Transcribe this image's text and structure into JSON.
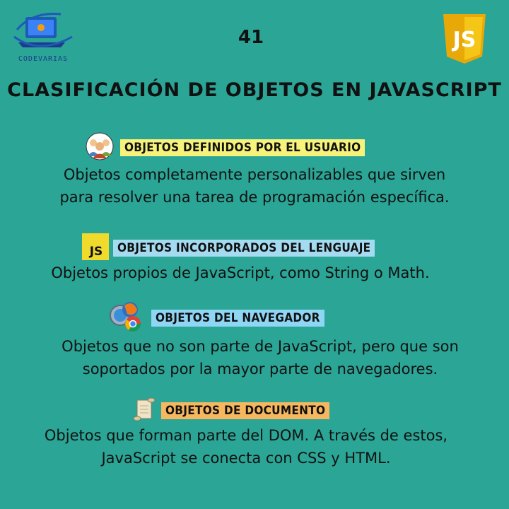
{
  "header": {
    "logo_text": "CODEVARIAS",
    "page_number": "41",
    "js_badge": "JS"
  },
  "title": "CLASIFICACIÓN DE OBJETOS EN JAVASCRIPT",
  "sections": [
    {
      "heading": "OBJETOS DEFINIDOS POR EL USUARIO",
      "icon": "users-icon",
      "lines": [
        "Objetos completamente personalizables que sirven",
        "para resolver una tarea de programación específica."
      ]
    },
    {
      "heading": "OBJETOS INCORPORADOS DEL LENGUAJE",
      "icon": "js-icon",
      "icon_text": "JS",
      "lines": [
        "Objetos propios de JavaScript, como String o Math."
      ]
    },
    {
      "heading": "OBJETOS DEL NAVEGADOR",
      "icon": "browsers-icon",
      "lines": [
        "Objetos que no son parte de JavaScript, pero que son",
        "soportados por la mayor parte de navegadores."
      ]
    },
    {
      "heading": "OBJETOS DE DOCUMENTO",
      "icon": "scroll-icon",
      "lines": [
        "Objetos que forman parte del DOM. A través de estos,",
        "JavaScript se conecta con CSS y HTML."
      ]
    }
  ],
  "colors": {
    "background": "#2aa596",
    "highlight_yellow": "#f7f37a",
    "highlight_blue": "#8fd6f5",
    "highlight_orange": "#f7b75f",
    "js_yellow": "#f0c419"
  }
}
